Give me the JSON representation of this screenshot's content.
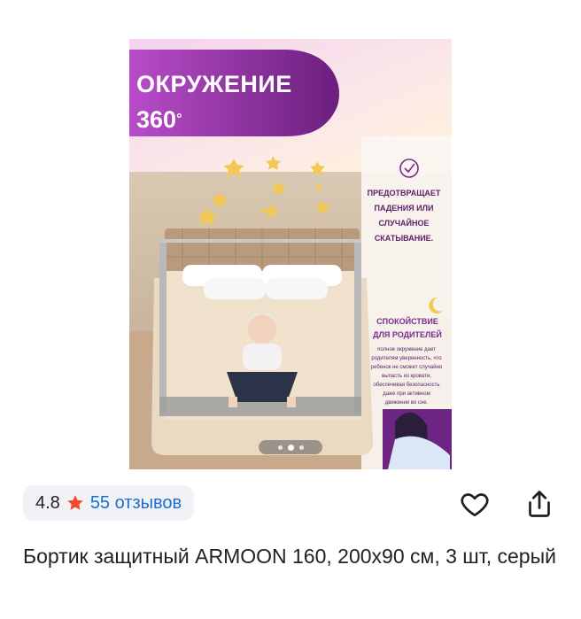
{
  "product": {
    "image": {
      "banner_title": "ОКРУЖЕНИЕ",
      "banner_number": "360",
      "banner_degree": "°",
      "feature1": [
        "ПРЕДОТВРАЩАЕТ",
        "ПАДЕНИЯ ИЛИ",
        "СЛУЧАЙНОЕ",
        "СКАТЫВАНИЕ."
      ],
      "feature2_title": [
        "СПОКОЙСТВИЕ",
        "ДЛЯ РОДИТЕЛЕЙ"
      ],
      "feature2_text": [
        "полное окружение дает",
        "родителям уверенность, что",
        "ребенок не сможет случайно",
        "выпасть из кровати,",
        "обеспечивая безопасность",
        "даже при активном",
        "движении во сне."
      ]
    },
    "gallery": {
      "dots": 3,
      "active_dot": 1
    },
    "rating": "4.8",
    "reviews": "55 отзывов",
    "title": "Бортик защитный ARMOON 160, 200х90 см, 3 шт, серый"
  },
  "actions": {
    "favorite_icon": "heart-outline-icon",
    "share_icon": "share-icon"
  },
  "colors": {
    "accent_purple": "#8a2a9b",
    "star": "#f24a2f",
    "link": "#1a6fd1",
    "chip_bg": "#f1f2f5"
  }
}
